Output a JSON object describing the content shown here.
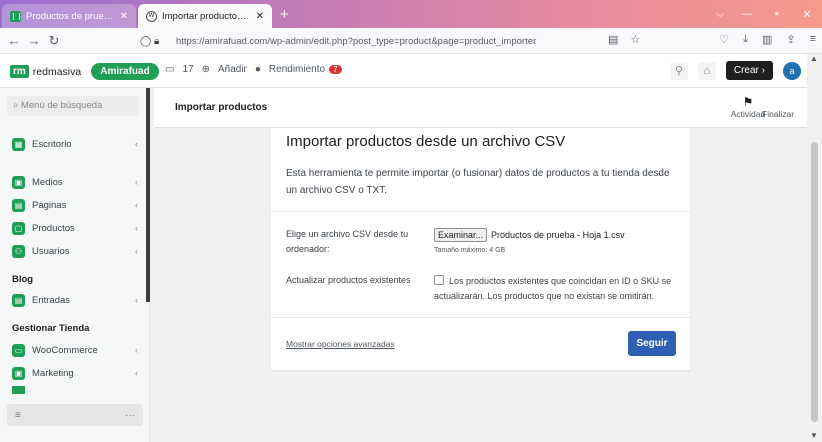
{
  "browser": {
    "tabs": [
      {
        "title": "Productos de prueba - Hojas de cál",
        "icon": "sheets-icon",
        "active": false
      },
      {
        "title": "Importar productos ‹ Amirafuad",
        "icon": "wordpress-icon",
        "active": true
      }
    ],
    "url": "https://amirafuad.com/wp-admin/edit.php?post_type=product&page=product_importer"
  },
  "adminbar": {
    "logo": "rm",
    "site_name": "redmasiva",
    "site_badge": "Amirafuad",
    "comments_count": "17",
    "add_label": "Añadir",
    "performance_label": "Rendimiento",
    "performance_badge": "7",
    "create_label": "Crear ›",
    "avatar_letter": "a"
  },
  "sidebar": {
    "search_placeholder": "Menú de búsqueda",
    "items": [
      {
        "label": "Escritorio"
      },
      {
        "label": "Medios"
      },
      {
        "label": "Páginas"
      },
      {
        "label": "Productos"
      },
      {
        "label": "Usuarios"
      }
    ],
    "blog_heading": "Blog",
    "blog_items": [
      {
        "label": "Entradas"
      }
    ],
    "store_heading": "Gestionar Tienda",
    "store_items": [
      {
        "label": "WooCommerce"
      },
      {
        "label": "Marketing"
      }
    ],
    "bottom_icon": "≡",
    "bottom_more": "···"
  },
  "page": {
    "title": "Importar productos",
    "activity_label": "Actividad",
    "finish_label": "Finalizar"
  },
  "importer": {
    "heading": "Importar productos desde un archivo CSV",
    "description": "Esta herramienta te permite importar (o fusionar) datos de productos a tu tienda desde un archivo CSV o TXT.",
    "file_label": "Elige un archivo CSV desde tu ordenador:",
    "browse_label": "Examinar...",
    "file_name": "Productos de prueba - Hoja 1.csv",
    "max_size": "Tamaño máximo: 4 GB",
    "update_label": "Actualizar productos existentes",
    "update_checked": false,
    "update_desc": "Los productos existentes que coincidan en ID o SKU se actualizarán. Los productos que no existan se omitirán.",
    "advanced_label": "Mostrar opciones avanzadas",
    "next_label": "Seguir"
  }
}
